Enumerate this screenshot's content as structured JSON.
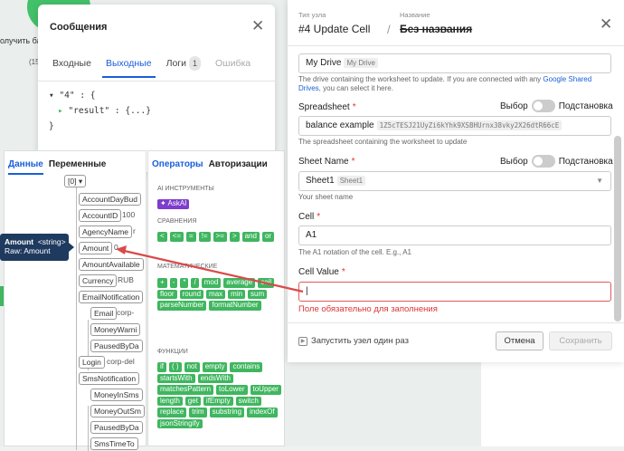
{
  "background": {
    "snippet1": "олучить бал",
    "snippet2": "(15"
  },
  "messages": {
    "title": "Сообщения",
    "tabs": [
      {
        "label": "Входные"
      },
      {
        "label": "Выходные"
      },
      {
        "label": "Логи",
        "badge": "1"
      },
      {
        "label": "Ошибка"
      }
    ],
    "json_line1": "\"4\" : {",
    "json_line2": "\"result\" : {...}",
    "json_line3": "}"
  },
  "picker": {
    "tabs": [
      "Данные",
      "Переменные"
    ],
    "index_label": "[0]",
    "nodes": [
      {
        "label": "AccountDayBud",
        "value": ""
      },
      {
        "label": "AccountID",
        "value": "100"
      },
      {
        "label": "AgencyName",
        "value": "r"
      },
      {
        "label": "Amount",
        "value": "0"
      },
      {
        "label": "AmountAvailable",
        "value": ""
      },
      {
        "label": "Currency",
        "value": "RUB"
      },
      {
        "label": "EmailNotification",
        "value": ""
      },
      {
        "label": "Email",
        "value": "corp-"
      },
      {
        "label": "MoneyWarni",
        "value": ""
      },
      {
        "label": "PausedByDa",
        "value": ""
      },
      {
        "label": "Login",
        "value": "corp-del"
      },
      {
        "label": "SmsNotification",
        "value": ""
      },
      {
        "label": "MoneyInSms",
        "value": ""
      },
      {
        "label": "MoneyOutSm",
        "value": ""
      },
      {
        "label": "PausedByDa",
        "value": ""
      },
      {
        "label": "SmsTimeTo",
        "value": ""
      }
    ]
  },
  "tooltip": {
    "name": "Amount",
    "type": "<string>",
    "raw": "Raw: Amount"
  },
  "operators": {
    "tabs": [
      "Операторы",
      "Авторизации"
    ],
    "sections": [
      {
        "title": "AI ИНСТРУМЕНТЫ",
        "items": [
          "AskAI"
        ]
      },
      {
        "title": "СРАВНЕНИЯ",
        "items": [
          "<",
          "<=",
          "=",
          "!=",
          ">=",
          ">",
          "and",
          "or"
        ]
      },
      {
        "title": "МАТЕМАТИЧЕСКИЕ",
        "items": [
          "+",
          "-",
          "*",
          "/",
          "mod",
          "average",
          "ceil",
          "floor",
          "round",
          "max",
          "min",
          "sum",
          "parseNumber",
          "formatNumber"
        ]
      },
      {
        "title": "ФУНКЦИИ",
        "items": [
          "if",
          "( )",
          "not",
          "empty",
          "contains",
          "startsWith",
          "endsWith",
          "matchesPattern",
          "toLower",
          "toUpper",
          "length",
          "get",
          "ifEmpty",
          "switch",
          "replace",
          "trim",
          "substring",
          "indexOf",
          "jsonStringify"
        ]
      }
    ]
  },
  "node_panel": {
    "type_label": "Тип узла",
    "type_value": "#4 Update Cell",
    "name_label": "Название",
    "name_value": "Без названия",
    "drive": {
      "value": "My Drive",
      "tag": "My Drive"
    },
    "drive_help_pre": "The drive containing the worksheet to update. If you are connected with any ",
    "drive_help_link": "Google Shared Drives",
    "drive_help_post": ", you can select it here.",
    "spreadsheet": {
      "label": "Spreadsheet",
      "toggle_left": "Выбор",
      "toggle_right": "Подстановка",
      "value": "balance example",
      "id": "1Z5cTESJ21UyZi6kYhk9XSBHUrnx38vky2X26dtR66cE",
      "help": "The spreadsheet containing the worksheet to update"
    },
    "sheet": {
      "label": "Sheet Name",
      "toggle_left": "Выбор",
      "toggle_right": "Подстановка",
      "value": "Sheet1",
      "tag": "Sheet1",
      "help": "Your sheet name"
    },
    "cell": {
      "label": "Cell",
      "value": "A1",
      "help": "The A1 notation of the cell. E.g., A1"
    },
    "cell_value": {
      "label": "Cell Value",
      "value": "|",
      "error": "Поле обязательно для заполнения"
    },
    "run_label": "Запустить узел один раз",
    "cancel": "Отмена",
    "save": "Сохранить"
  }
}
